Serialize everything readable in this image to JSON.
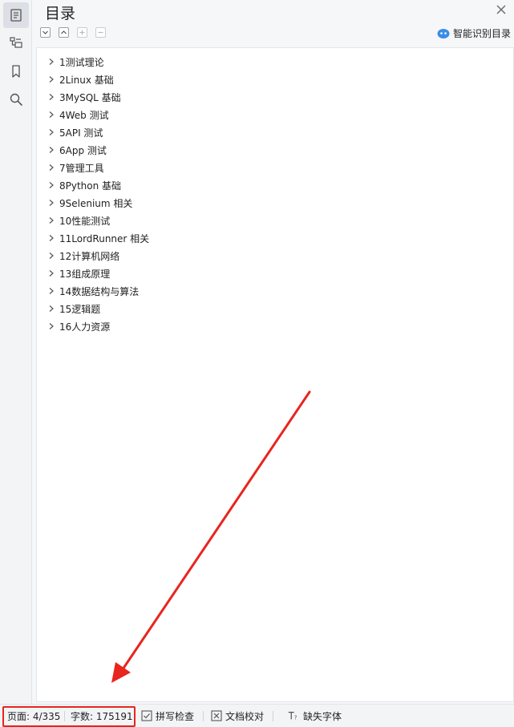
{
  "panel": {
    "title": "目录",
    "smart_label": "智能识别目录"
  },
  "icons": {
    "rail": [
      "toc-icon",
      "outline-icon",
      "bookmark-icon",
      "search-icon"
    ],
    "toolbar": [
      "expand-all-icon",
      "collapse-all-icon",
      "add-item-icon",
      "remove-item-icon"
    ]
  },
  "toc": {
    "items": [
      "1测试理论",
      "2Linux  基础",
      "3MySQL 基础",
      "4Web 测试",
      "5API  测试",
      "6App  测试",
      "7管理工具",
      "8Python  基础",
      "9Selenium  相关",
      "10性能测试",
      "11LordRunner 相关",
      "12计算机网络",
      "13组成原理",
      "14数据结构与算法",
      "15逻辑题",
      "16人力资源"
    ]
  },
  "status": {
    "page": "页面: 4/335",
    "words": "字数: 175191",
    "spellcheck": "拼写检查",
    "proofread": "文档校对",
    "missing_fonts": "缺失字体"
  },
  "colors": {
    "highlight": "#e8251e",
    "smart_icon": "#3a8ee6"
  }
}
